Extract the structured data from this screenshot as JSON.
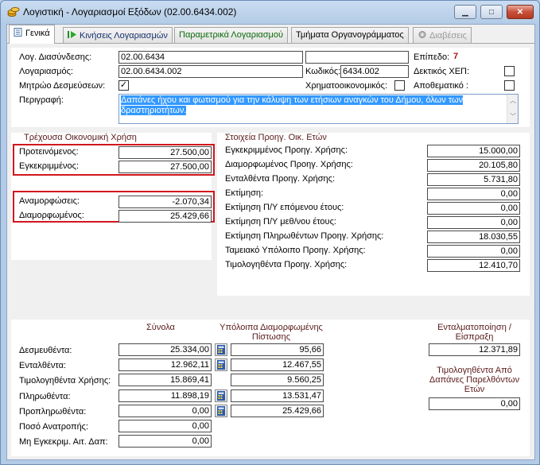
{
  "window": {
    "title": "Λογιστική - Λογαριασμοί Εξόδων (02.00.6434.002)",
    "buttons": {
      "minimize": "▁",
      "maximize": "□",
      "close": "✕"
    }
  },
  "tabs": [
    {
      "label": "Γενικά",
      "icon": "page-icon"
    },
    {
      "label": "Κινήσεις Λογαριασμών",
      "icon": "play-icon"
    },
    {
      "label": "Παραμετρικά Λογαριασμού",
      "icon": ""
    },
    {
      "label": "Τμήματα Οργανογράμματος",
      "icon": ""
    },
    {
      "label": "Διαβέσεις",
      "icon": "gear-icon"
    }
  ],
  "general": {
    "log_diasyndesis_label": "Λογ. Διασύνδεσης:",
    "log_diasyndesis_value": "02.00.6434",
    "extra_field_value": "",
    "level_label": "Επίπεδο:",
    "level_value": "7",
    "account_label": "Λογαριασμός:",
    "account_value": "02.00.6434.002",
    "code_label": "Κωδικός:",
    "code_value": "6434.002",
    "dektikos_label": "Δεκτικός ΧΕΠ:",
    "mitrwo_label": "Μητρώο Δεσμεύσεων:",
    "mitrwo_checked": "✓",
    "xrimatoik_label": "Χρηματοοικονομικός:",
    "apothematiko_label": "Αποθεματικό :",
    "description_label": "Περιγραφή:",
    "description_value": "Δαπάνες ήχου και φωτισμού για την κάλυψη των ετήσιων αναγκών του Δήμου, όλων των δραστηριοτήτων."
  },
  "current_year": {
    "title": "Τρέχουσα Οικονομική Χρήση",
    "rows": [
      {
        "label": "Προτεινόμενος:",
        "value": "27.500,00"
      },
      {
        "label": "Εγκεκριμμένος:",
        "value": "27.500,00"
      }
    ],
    "rows2": [
      {
        "label": "Αναμορφώσεις:",
        "value": "-2.070,34"
      },
      {
        "label": "Διαμορφωμένος:",
        "value": "25.429,66"
      }
    ]
  },
  "previous_years": {
    "title": "Στοιχεία Προηγ. Οικ. Ετών",
    "rows": [
      {
        "label": "Εγκεκριμμένος Προηγ. Χρήσης:",
        "value": "15.000,00"
      },
      {
        "label": "Διαμορφωμένος Προηγ. Χρήσης:",
        "value": "20.105,80"
      },
      {
        "label": "Ενταλθέντα Προηγ. Χρήσης:",
        "value": "5.731,80"
      },
      {
        "label": "Εκτίμηση:",
        "value": "0,00"
      },
      {
        "label": "Εκτίμηση Π/Υ επόμενου έτους:",
        "value": "0,00"
      },
      {
        "label": "Εκτίμηση Π/Υ μεθ/νου έτους:",
        "value": "0,00"
      },
      {
        "label": "Εκτίμηση Πληρωθέντων Προηγ. Χρήσης:",
        "value": "18.030,55"
      },
      {
        "label": "Ταμειακό Υπόλοιπο Προηγ. Χρήσης:",
        "value": "0,00"
      },
      {
        "label": "Τιμολογηθέντα Προηγ. Χρήσης:",
        "value": "12.410,70"
      }
    ]
  },
  "totals": {
    "col_totals": "Σύνολα",
    "col_remaining": "Υπόλοιπα Διαμορφωμένης Πίστωσης",
    "col_entalmatopoiisi": "Ενταλματοποίηση / Είσπραξη",
    "entalmatopoiisi_value": "12.371,89",
    "prev_years_title": "Τιμολογηθέντα Από Δαπάνες Παρελθόντων Ετών",
    "prev_years_value": "0,00",
    "rows": [
      {
        "label": "Δεσμευθέντα:",
        "total": "25.334,00",
        "remaining": "95,66"
      },
      {
        "label": "Ενταλθέντα:",
        "total": "12.962,11",
        "remaining": "12.467,55"
      },
      {
        "label": "Τιμολογηθέντα Χρήσης:",
        "total": "15.869,41",
        "remaining": "9.560,25"
      },
      {
        "label": "Πληρωθέντα:",
        "total": "11.898,19",
        "remaining": "13.531,47"
      },
      {
        "label": "Προπληρωθέντα:",
        "total": "0,00",
        "remaining": "25.429,66"
      },
      {
        "label": "Ποσό Ανατροπής:",
        "total": "0,00"
      },
      {
        "label": "Μη Εγκεκριμ. Αιτ. Δαπ:",
        "total": "0,00"
      }
    ]
  },
  "colors": {
    "highlight_border": "#d2161e",
    "section_title": "#5a1a1a",
    "level_value": "#b01010",
    "selection": "#3399ff"
  }
}
